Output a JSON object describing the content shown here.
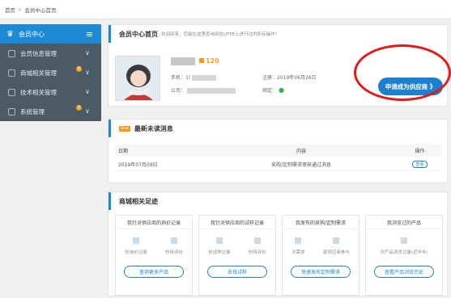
{
  "breadcrumb": {
    "home": "首页",
    "separator": ">",
    "current": "会员中心首页"
  },
  "sidebar": {
    "header": "会员中心",
    "items": [
      {
        "label": "会员信息管理",
        "badge": ""
      },
      {
        "label": "商城相关管理",
        "badge": "0"
      },
      {
        "label": "技术相关管理",
        "badge": ""
      },
      {
        "label": "系统管理",
        "badge": "1"
      }
    ]
  },
  "profile": {
    "title": "会员中心首页",
    "welcome": "欢迎回来，您能在这里查询到在UTPE上进行过的所有操作！",
    "score": "120",
    "phone_label": "手机：",
    "phone_value": "1(",
    "register_label": "注册：",
    "register_date": "2019年06月26日",
    "company_label": "公司：",
    "bind_label": "绑定：",
    "apply_button": "申请成为供应商 》"
  },
  "messages": {
    "new_tag": "New",
    "title": "最新未读消息",
    "columns": {
      "date": "日期",
      "content": "内容",
      "op": "操作"
    },
    "rows": [
      {
        "date": "2019年07月09日",
        "content": "采购/定制需求审核通过消息",
        "op": "查看"
      }
    ]
  },
  "footprint": {
    "title": "商城相关足迹",
    "boxes": [
      {
        "title": "我针对供应商的询价记录",
        "a": "份询价记录",
        "b": "份待评价",
        "button": "查询更多产品"
      },
      {
        "title": "我针对供应商的试样记录",
        "a": "份试样记录",
        "b": "份待评价",
        "button": "去找试样"
      },
      {
        "title": "我发布的采购/定制需求",
        "a": "次需求",
        "b": "家供应商参与",
        "button": "快速发布定制需求"
      },
      {
        "title": "我浏览过的产品",
        "a": "次产品浏览记录(近半年)",
        "b": "",
        "button": "查看产品浏览历史"
      }
    ]
  },
  "colors": {
    "accent": "#1e8ad6",
    "sidebar": "#4c5a66",
    "highlight": "#e21a1a",
    "score": "#f39a1e"
  }
}
